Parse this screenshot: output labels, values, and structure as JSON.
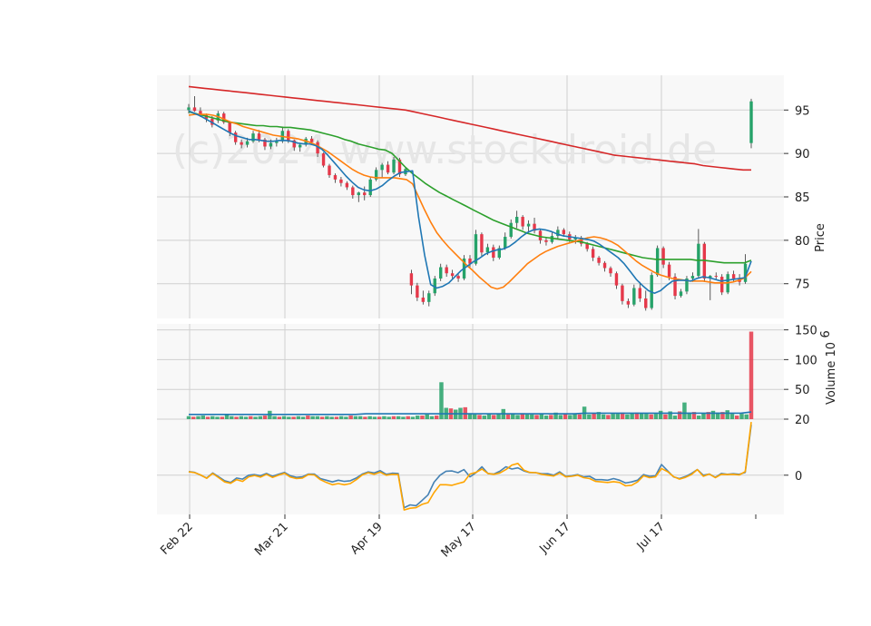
{
  "watermark": "(c)2024 www.stockdroid.de",
  "colors": {
    "up": "#26a269",
    "down": "#e5384a",
    "wick": "#333333",
    "sma_fast": "#1f77b4",
    "sma_mid": "#ff7f0e",
    "sma_slow": "#2ca02c",
    "sma_long": "#d62728",
    "osc_a": "#4682b4",
    "osc_b": "#ffa500",
    "grid": "#d0d0d0",
    "bg": "#f8f8f8"
  },
  "chart_data": {
    "type": "candlestick",
    "x_ticks": [
      "Feb 22",
      "Mar 21",
      "Apr 19",
      "May 17",
      "Jun 17",
      "Jul 17"
    ],
    "price_panel": {
      "ylabel": "Price",
      "y_ticks": [
        75,
        80,
        85,
        90,
        95
      ],
      "ylim": [
        71,
        99
      ],
      "candles": [
        [
          95.0,
          95.7,
          94.6,
          95.3
        ],
        [
          95.3,
          96.6,
          94.8,
          94.9
        ],
        [
          94.9,
          95.3,
          94.2,
          94.4
        ],
        [
          94.4,
          94.6,
          93.6,
          94.0
        ],
        [
          94.0,
          94.3,
          93.0,
          93.3
        ],
        [
          93.8,
          94.9,
          93.5,
          94.6
        ],
        [
          94.6,
          94.8,
          93.4,
          93.6
        ],
        [
          93.6,
          93.7,
          92.0,
          92.4
        ],
        [
          92.4,
          92.6,
          91.0,
          91.3
        ],
        [
          91.3,
          91.6,
          90.6,
          91.0
        ],
        [
          91.0,
          91.8,
          90.7,
          91.4
        ],
        [
          91.4,
          92.6,
          91.2,
          92.3
        ],
        [
          92.3,
          92.7,
          91.3,
          91.6
        ],
        [
          91.6,
          91.8,
          90.4,
          90.8
        ],
        [
          90.8,
          91.6,
          90.5,
          91.2
        ],
        [
          91.2,
          91.8,
          90.8,
          91.4
        ],
        [
          91.4,
          93.0,
          91.2,
          92.6
        ],
        [
          92.6,
          92.8,
          91.2,
          91.5
        ],
        [
          91.5,
          91.6,
          90.3,
          90.7
        ],
        [
          90.7,
          91.2,
          90.2,
          91.0
        ],
        [
          91.0,
          91.9,
          90.8,
          91.7
        ],
        [
          91.7,
          92.0,
          91.1,
          91.3
        ],
        [
          91.3,
          91.5,
          89.6,
          90.0
        ],
        [
          90.0,
          90.1,
          88.4,
          88.6
        ],
        [
          88.6,
          88.8,
          87.2,
          87.5
        ],
        [
          87.5,
          87.7,
          86.6,
          87.0
        ],
        [
          87.0,
          87.3,
          86.2,
          86.6
        ],
        [
          86.6,
          86.8,
          85.8,
          86.1
        ],
        [
          86.1,
          86.3,
          84.8,
          85.2
        ],
        [
          85.2,
          85.6,
          84.4,
          85.5
        ],
        [
          85.5,
          86.2,
          84.6,
          85.2
        ],
        [
          85.2,
          87.3,
          85.0,
          87.0
        ],
        [
          87.0,
          88.4,
          86.8,
          88.1
        ],
        [
          88.1,
          88.9,
          87.2,
          88.7
        ],
        [
          88.7,
          89.1,
          87.6,
          87.8
        ],
        [
          87.8,
          89.6,
          87.6,
          89.3
        ],
        [
          89.3,
          89.5,
          87.3,
          87.6
        ],
        [
          87.6,
          88.4,
          87.4,
          88.2
        ],
        [
          76.2,
          76.6,
          73.8,
          74.8
        ],
        [
          74.8,
          75.1,
          73.0,
          73.4
        ],
        [
          73.4,
          74.2,
          72.6,
          72.9
        ],
        [
          72.9,
          74.2,
          72.4,
          73.9
        ],
        [
          73.9,
          75.9,
          73.6,
          75.6
        ],
        [
          75.6,
          77.3,
          75.3,
          76.9
        ],
        [
          76.9,
          77.2,
          75.8,
          76.2
        ],
        [
          76.2,
          76.6,
          75.6,
          75.9
        ],
        [
          75.9,
          76.2,
          75.2,
          75.6
        ],
        [
          75.6,
          78.3,
          75.4,
          77.9
        ],
        [
          77.9,
          78.3,
          76.9,
          77.3
        ],
        [
          77.3,
          81.2,
          77.1,
          80.7
        ],
        [
          80.7,
          80.9,
          78.2,
          78.6
        ],
        [
          78.6,
          79.6,
          78.3,
          79.2
        ],
        [
          79.2,
          79.5,
          77.6,
          78.0
        ],
        [
          78.0,
          79.4,
          77.8,
          79.1
        ],
        [
          79.1,
          80.9,
          78.9,
          80.4
        ],
        [
          80.4,
          82.4,
          80.2,
          82.0
        ],
        [
          82.0,
          83.4,
          81.4,
          82.7
        ],
        [
          82.7,
          82.9,
          81.2,
          81.6
        ],
        [
          81.6,
          82.3,
          81.0,
          81.9
        ],
        [
          81.9,
          82.6,
          80.8,
          81.1
        ],
        [
          81.1,
          81.3,
          79.6,
          80.0
        ],
        [
          80.0,
          80.4,
          79.4,
          79.8
        ],
        [
          79.8,
          80.9,
          79.6,
          80.5
        ],
        [
          80.5,
          81.6,
          80.2,
          81.2
        ],
        [
          81.2,
          81.4,
          80.4,
          80.7
        ],
        [
          80.7,
          81.0,
          79.8,
          80.1
        ],
        [
          80.1,
          80.6,
          79.6,
          80.3
        ],
        [
          80.3,
          80.5,
          79.3,
          79.6
        ],
        [
          79.6,
          79.8,
          78.7,
          79.0
        ],
        [
          79.0,
          79.3,
          77.6,
          78.0
        ],
        [
          78.0,
          78.2,
          77.1,
          77.4
        ],
        [
          77.4,
          77.6,
          76.4,
          76.8
        ],
        [
          76.8,
          77.0,
          75.8,
          76.2
        ],
        [
          76.2,
          76.4,
          74.4,
          74.8
        ],
        [
          74.8,
          75.0,
          72.6,
          73.0
        ],
        [
          73.0,
          73.3,
          72.2,
          72.6
        ],
        [
          72.6,
          74.9,
          72.4,
          74.5
        ],
        [
          74.5,
          75.2,
          72.9,
          73.3
        ],
        [
          73.3,
          74.2,
          71.9,
          72.2
        ],
        [
          72.2,
          76.3,
          72.0,
          76.0
        ],
        [
          76.0,
          79.4,
          75.8,
          79.1
        ],
        [
          79.1,
          79.3,
          76.8,
          77.2
        ],
        [
          77.2,
          77.5,
          75.4,
          75.8
        ],
        [
          75.8,
          76.2,
          73.2,
          73.6
        ],
        [
          73.6,
          74.4,
          73.4,
          74.1
        ],
        [
          74.1,
          75.9,
          73.8,
          75.6
        ],
        [
          75.6,
          76.3,
          75.2,
          75.9
        ],
        [
          75.9,
          81.3,
          75.7,
          79.6
        ],
        [
          79.6,
          79.8,
          75.2,
          75.6
        ],
        [
          75.6,
          76.0,
          73.1,
          75.9
        ],
        [
          75.9,
          76.3,
          75.5,
          75.8
        ],
        [
          75.8,
          76.1,
          73.7,
          74.0
        ],
        [
          74.0,
          76.4,
          73.8,
          76.1
        ],
        [
          76.1,
          76.5,
          75.2,
          75.6
        ],
        [
          75.6,
          76.1,
          74.8,
          75.2
        ],
        [
          75.2,
          78.4,
          75.0,
          77.3
        ],
        [
          91.2,
          96.3,
          90.6,
          96.0
        ]
      ],
      "sma_fast": [
        94.9,
        94.6,
        94.3,
        93.9,
        93.5,
        93.1,
        92.7,
        92.3,
        92.0,
        91.8,
        91.6,
        91.6,
        91.5,
        91.4,
        91.4,
        91.5,
        91.5,
        91.4,
        91.2,
        91.1,
        91.1,
        90.9,
        90.5,
        89.8,
        89.0,
        88.2,
        87.4,
        86.7,
        86.1,
        85.8,
        85.7,
        85.9,
        86.3,
        86.9,
        87.4,
        87.8,
        87.9,
        88.0,
        82.7,
        78.3,
        74.9,
        74.5,
        74.7,
        75.1,
        75.8,
        76.5,
        77.0,
        77.5,
        77.9,
        78.4,
        78.7,
        78.9,
        79.0,
        79.3,
        79.8,
        80.4,
        80.9,
        81.2,
        81.3,
        81.2,
        81.0,
        80.7,
        80.5,
        80.4,
        80.3,
        80.2,
        80.1,
        79.9,
        79.5,
        79.0,
        78.5,
        78.0,
        77.3,
        76.4,
        75.5,
        74.8,
        74.2,
        73.9,
        74.2,
        74.8,
        75.3,
        75.4,
        75.4,
        75.3,
        75.6,
        75.8,
        75.7,
        75.5,
        75.3,
        75.4,
        75.5,
        75.6,
        75.7,
        77.6
      ],
      "sma_mid": [
        94.4,
        94.5,
        94.5,
        94.5,
        94.4,
        94.2,
        93.9,
        93.6,
        93.4,
        93.1,
        92.9,
        92.7,
        92.5,
        92.3,
        92.1,
        92.0,
        91.9,
        91.8,
        91.7,
        91.5,
        91.3,
        91.0,
        90.6,
        90.2,
        89.7,
        89.2,
        88.7,
        88.2,
        87.8,
        87.5,
        87.3,
        87.2,
        87.2,
        87.2,
        87.2,
        87.1,
        87.0,
        86.5,
        85.0,
        83.5,
        82.1,
        80.9,
        80.0,
        79.2,
        78.5,
        77.8,
        77.1,
        76.5,
        75.8,
        75.2,
        74.6,
        74.4,
        74.6,
        75.2,
        75.9,
        76.6,
        77.3,
        77.8,
        78.3,
        78.7,
        79.0,
        79.3,
        79.5,
        79.7,
        79.9,
        80.1,
        80.3,
        80.4,
        80.3,
        80.1,
        79.8,
        79.4,
        78.8,
        78.2,
        77.6,
        77.1,
        76.7,
        76.3,
        76.0,
        75.8,
        75.6,
        75.5,
        75.4,
        75.3,
        75.3,
        75.3,
        75.2,
        75.1,
        75.1,
        75.1,
        75.2,
        75.4,
        75.7,
        76.4
      ],
      "sma_slow": [
        94.8,
        94.6,
        94.4,
        94.2,
        94.0,
        93.8,
        93.6,
        93.5,
        93.4,
        93.3,
        93.2,
        93.2,
        93.1,
        93.1,
        93.0,
        93.0,
        92.9,
        92.8,
        92.7,
        92.5,
        92.3,
        92.1,
        91.9,
        91.6,
        91.4,
        91.1,
        90.9,
        90.7,
        90.5,
        90.4,
        90.0,
        89.2,
        88.4,
        87.7,
        87.1,
        86.5,
        86.0,
        85.5,
        85.1,
        84.7,
        84.3,
        83.9,
        83.5,
        83.1,
        82.7,
        82.3,
        82.0,
        81.7,
        81.4,
        81.1,
        80.8,
        80.6,
        80.4,
        80.3,
        80.2,
        80.1,
        80.0,
        79.9,
        79.8,
        79.6,
        79.4,
        79.2,
        79.0,
        78.8,
        78.6,
        78.4,
        78.2,
        78.0,
        77.9,
        77.8,
        77.8,
        77.8,
        77.8,
        77.8,
        77.8,
        77.7,
        77.7,
        77.6,
        77.5,
        77.4,
        77.4,
        77.4,
        77.4,
        77.7
      ],
      "sma_long": [
        97.7,
        97.6,
        97.5,
        97.4,
        97.3,
        97.2,
        97.1,
        97.0,
        96.9,
        96.8,
        96.7,
        96.6,
        96.5,
        96.4,
        96.3,
        96.2,
        96.1,
        96.0,
        95.9,
        95.8,
        95.7,
        95.6,
        95.5,
        95.4,
        95.3,
        95.2,
        95.1,
        95.0,
        94.8,
        94.6,
        94.4,
        94.2,
        94.0,
        93.8,
        93.6,
        93.4,
        93.2,
        93.0,
        92.8,
        92.6,
        92.4,
        92.2,
        92.0,
        91.8,
        91.6,
        91.4,
        91.2,
        91.0,
        90.8,
        90.6,
        90.4,
        90.2,
        90.0,
        89.8,
        89.7,
        89.6,
        89.5,
        89.4,
        89.3,
        89.2,
        89.1,
        89.0,
        88.9,
        88.8,
        88.6,
        88.5,
        88.4,
        88.3,
        88.2,
        88.1,
        88.1
      ]
    },
    "volume_panel": {
      "ylabel": "Volume  10^6",
      "y_ticks": [
        50,
        100,
        150
      ],
      "ylim": [
        0,
        160
      ],
      "values": [
        5,
        4,
        5,
        6,
        4,
        5,
        4,
        4,
        7,
        5,
        4,
        5,
        4,
        5,
        4,
        5,
        6,
        14,
        5,
        4,
        5,
        4,
        4,
        5,
        4,
        6,
        5,
        5,
        4,
        5,
        4,
        4,
        5,
        4,
        6,
        5,
        5,
        4,
        5,
        4,
        4,
        5,
        4,
        5,
        5,
        4,
        5,
        4,
        6,
        6,
        8,
        5,
        6,
        62,
        19,
        18,
        16,
        19,
        20,
        10,
        8,
        7,
        6,
        9,
        7,
        9,
        17,
        8,
        9,
        7,
        10,
        8,
        8,
        7,
        9,
        6,
        7,
        11,
        7,
        9,
        7,
        9,
        8,
        21,
        8,
        10,
        12,
        8,
        7,
        9,
        9,
        11,
        8,
        10,
        11,
        10,
        9,
        8,
        9,
        14,
        8,
        13,
        6,
        13,
        28,
        11,
        12,
        6,
        10,
        12,
        14,
        11,
        12,
        15,
        9,
        6,
        9,
        8,
        147
      ],
      "avg": [
        8,
        8,
        8,
        8,
        8,
        8,
        8,
        8,
        8,
        8,
        8,
        8,
        8,
        8,
        8,
        8,
        8,
        9,
        9,
        9,
        9,
        9,
        9,
        9,
        9,
        9,
        9,
        9,
        9,
        9,
        9,
        9,
        9,
        9,
        9,
        9,
        9,
        9,
        10,
        10,
        10,
        10,
        10,
        10,
        10,
        10,
        10,
        10,
        10,
        10,
        10,
        10,
        10,
        10,
        12
      ]
    },
    "oscillator_panel": {
      "y_ticks": [
        0,
        20
      ],
      "ylim": [
        -14,
        20
      ],
      "line_a": [
        1.3,
        1.0,
        0.0,
        -1.0,
        0.8,
        -0.6,
        -2.0,
        -2.6,
        -1.0,
        -1.4,
        0.0,
        0.2,
        -0.2,
        0.6,
        -0.4,
        0.3,
        1.0,
        -0.2,
        -0.8,
        -0.6,
        0.4,
        0.4,
        -1.2,
        -1.8,
        -2.4,
        -1.8,
        -2.2,
        -2.0,
        -1.0,
        0.4,
        1.2,
        0.8,
        1.6,
        0.3,
        0.7,
        0.6,
        -11.6,
        -10.6,
        -10.9,
        -9.0,
        -7.0,
        -2.5,
        0.0,
        1.4,
        1.5,
        0.9,
        2.0,
        -0.6,
        0.9,
        3.0,
        0.6,
        0.4,
        1.4,
        3.0,
        2.2,
        2.6,
        1.5,
        0.9,
        0.9,
        0.5,
        0.5,
        0.0,
        1.2,
        -0.4,
        -0.2,
        0.2,
        -0.6,
        -0.4,
        -1.6,
        -1.6,
        -1.8,
        -1.2,
        -1.8,
        -2.8,
        -2.4,
        -1.8,
        0.2,
        -0.4,
        -0.2,
        3.8,
        1.6,
        -0.6,
        -1.2,
        -0.5,
        0.6,
        2.0,
        0.0,
        0.4,
        -0.8,
        0.6,
        0.3,
        0.5,
        0.3,
        1.0,
        18.0
      ],
      "line_b": [
        1.2,
        0.9,
        0.1,
        -1.1,
        0.6,
        -0.9,
        -2.4,
        -2.9,
        -1.6,
        -2.2,
        -0.6,
        -0.1,
        -0.7,
        0.3,
        -0.8,
        0.0,
        0.7,
        -0.7,
        -1.2,
        -1.0,
        0.2,
        0.1,
        -1.6,
        -2.6,
        -3.4,
        -3.0,
        -3.4,
        -3.0,
        -1.6,
        0.1,
        0.9,
        0.3,
        1.1,
        0.0,
        0.3,
        0.2,
        -12.4,
        -11.8,
        -11.6,
        -10.4,
        -9.8,
        -6.2,
        -3.4,
        -3.4,
        -3.6,
        -3.0,
        -2.4,
        0.4,
        1.0,
        2.2,
        0.6,
        0.3,
        0.8,
        2.0,
        3.6,
        4.2,
        1.8,
        1.0,
        0.9,
        0.3,
        0.0,
        -0.3,
        0.8,
        -0.6,
        -0.4,
        0.0,
        -0.9,
        -1.2,
        -2.2,
        -2.4,
        -2.6,
        -2.3,
        -2.6,
        -3.8,
        -3.6,
        -2.4,
        -0.2,
        -0.9,
        -0.6,
        2.4,
        1.3,
        -0.5,
        -1.4,
        -0.8,
        0.2,
        2.0,
        -0.4,
        0.4,
        -0.9,
        0.3,
        0.2,
        0.3,
        0.1,
        1.3,
        19.0
      ]
    }
  }
}
